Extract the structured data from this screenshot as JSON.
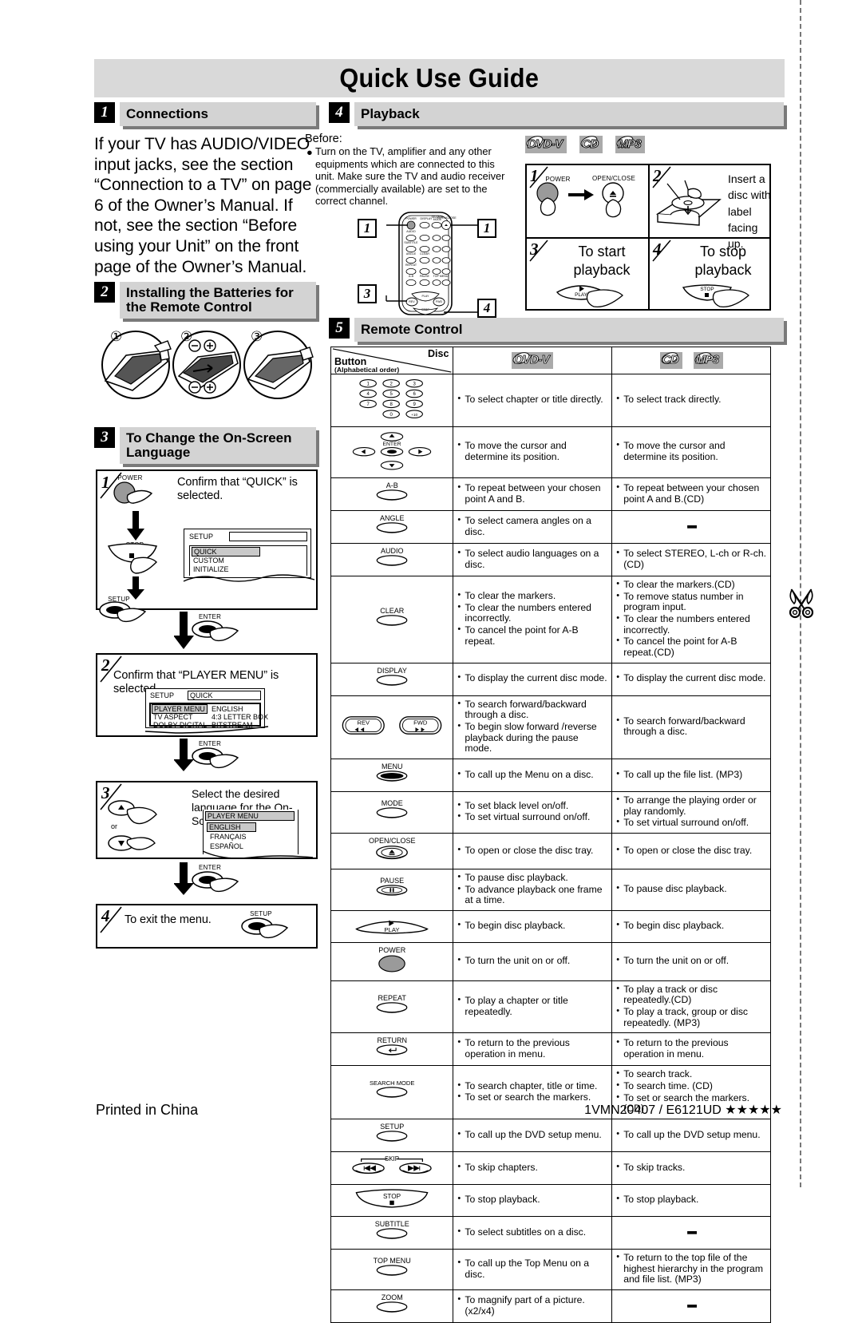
{
  "document": {
    "title": "Quick Use Guide",
    "footer_left": "Printed in China",
    "footer_right": "1VMN20407 / E6121UD ★★★★★"
  },
  "sections": {
    "connections": {
      "number": "1",
      "heading": "Connections",
      "body": "If your TV has AUDIO/VIDEO input jacks, see the section “Connection to a TV” on page 6 of the Owner’s Manual. If not, see the section “Before using your Unit” on the front page of the Owner’s Manual."
    },
    "batteries": {
      "number": "2",
      "heading": "Installing the Batteries for the Remote Control",
      "steps": [
        "1",
        "2",
        "3"
      ],
      "polarity": [
        "−",
        "+",
        "−",
        "+"
      ]
    },
    "language": {
      "number": "3",
      "heading": "To Change the On-Screen Language",
      "step1": {
        "number": "1",
        "instruction": "Confirm that “QUICK” is selected.",
        "buttons": [
          "POWER",
          "STOP",
          "SETUP"
        ],
        "osd_title": "SETUP",
        "osd_items": [
          "QUICK",
          "CUSTOM",
          "INITIALIZE"
        ],
        "osd_selected": "QUICK"
      },
      "connector1": "ENTER",
      "step2": {
        "number": "2",
        "instruction": "Confirm that “PLAYER MENU” is selected.",
        "osd_title": "SETUP",
        "osd_mode": "QUICK",
        "osd_rows": [
          {
            "label": "PLAYER MENU",
            "value": "ENGLISH"
          },
          {
            "label": "TV ASPECT",
            "value": "4:3 LETTER BOX"
          },
          {
            "label": "DOLBY DIGITAL",
            "value": "BITSTREAM"
          }
        ],
        "osd_selected": "PLAYER MENU"
      },
      "connector2": "ENTER",
      "step3": {
        "number": "3",
        "instruction": "Select the desired language for the On-Screen Display.",
        "or_label": "or",
        "osd_title": "PLAYER MENU",
        "osd_items": [
          "ENGLISH",
          "FRANÇAIS",
          "ESPAÑOL"
        ],
        "osd_selected": "ENGLISH"
      },
      "connector3": "ENTER",
      "step4": {
        "number": "4",
        "instruction": "To exit the menu.",
        "button": "SETUP"
      }
    },
    "playback": {
      "number": "4",
      "heading": "Playback",
      "before_label": "Before:",
      "before_text": "Turn on the TV, amplifier and any other equipments which are connected to this unit. Make sure the TV and audio receiver (commercially available) are set to the correct channel.",
      "disc_logos": [
        "DVD-V",
        "CD",
        "MP3"
      ],
      "remote_callouts": [
        "1",
        "1",
        "3",
        "4"
      ],
      "remote_labels": [
        "POWER",
        "DISPLAY",
        "SEARCH MODE",
        "OPEN/CLOSE",
        "AUDIO",
        "SUBTITLE",
        "ANGLE",
        "REPEAT",
        "CLEAR",
        "A-B",
        "PAUSE",
        "TOP MENU",
        "REV",
        "PLAY",
        "FWD",
        "STOP"
      ],
      "steps": [
        {
          "number": "1",
          "text": "",
          "button_left": "POWER",
          "button_right": "OPEN/CLOSE"
        },
        {
          "number": "2",
          "text": "Insert a disc with label facing up."
        },
        {
          "number": "3",
          "text": "To start playback",
          "button": "PLAY"
        },
        {
          "number": "4",
          "text": "To stop playback",
          "button": "STOP"
        }
      ]
    },
    "remote_control": {
      "number": "5",
      "heading": "Remote Control",
      "table": {
        "header": {
          "col1_top": "Disc",
          "col1_bottom": "Button",
          "col1_sub": "(Alphabetical order)",
          "col2": "DVD-V",
          "col3a": "CD",
          "col3b": "MP3"
        },
        "rows": [
          {
            "button": "NUMBERS",
            "button_keys": [
              "1",
              "2",
              "3",
              "4",
              "5",
              "6",
              "7",
              "8",
              "9",
              "0",
              "+10"
            ],
            "dvd": [
              "To select chapter or title directly."
            ],
            "cd": [
              "To select track directly."
            ]
          },
          {
            "button": "CURSOR/ENTER",
            "button_label": "ENTER",
            "dvd": [
              "To move the cursor and determine its position."
            ],
            "cd": [
              "To move the cursor and determine its position."
            ]
          },
          {
            "button": "A-B",
            "dvd": [
              "To repeat between your chosen point A and B."
            ],
            "cd": [
              "To repeat between your chosen point A and B.(CD)"
            ]
          },
          {
            "button": "ANGLE",
            "dvd": [
              "To select camera angles on a disc."
            ],
            "cd": []
          },
          {
            "button": "AUDIO",
            "dvd": [
              "To select audio languages on a disc."
            ],
            "cd": [
              "To select STEREO, L-ch or R-ch.(CD)"
            ]
          },
          {
            "button": "CLEAR",
            "dvd": [
              "To clear the markers.",
              "To clear the numbers entered incorrectly.",
              "To cancel the point for A-B repeat."
            ],
            "cd": [
              "To clear the markers.(CD)",
              "To remove status number in program input.",
              "To clear the numbers entered incorrectly.",
              "To cancel the point for A-B repeat.(CD)"
            ]
          },
          {
            "button": "DISPLAY",
            "dvd": [
              "To display the current disc mode."
            ],
            "cd": [
              "To display the current disc mode."
            ]
          },
          {
            "button": "REV/FWD",
            "button_left": "REV",
            "button_right": "FWD",
            "dvd": [
              "To search forward/backward through a disc.",
              "To begin slow forward /reverse playback during the pause mode."
            ],
            "cd": [
              "To search forward/backward through a disc."
            ]
          },
          {
            "button": "MENU",
            "dvd": [
              "To call up the Menu on a disc."
            ],
            "cd": [
              "To call up the file list. (MP3)"
            ]
          },
          {
            "button": "MODE",
            "dvd": [
              "To set black level on/off.",
              "To set virtual surround on/off."
            ],
            "cd": [
              "To arrange the playing order or play randomly.",
              "To set virtual surround on/off."
            ]
          },
          {
            "button": "OPEN/CLOSE",
            "dvd": [
              "To open or close the disc tray."
            ],
            "cd": [
              "To open or close the disc tray."
            ]
          },
          {
            "button": "PAUSE",
            "dvd": [
              "To pause disc playback.",
              "To advance playback one frame at a time."
            ],
            "cd": [
              "To pause disc playback."
            ]
          },
          {
            "button": "PLAY",
            "dvd": [
              "To begin disc playback."
            ],
            "cd": [
              "To begin disc playback."
            ]
          },
          {
            "button": "POWER",
            "dvd": [
              "To turn the unit on or off."
            ],
            "cd": [
              "To turn the unit on or off."
            ]
          },
          {
            "button": "REPEAT",
            "dvd": [
              "To play a chapter or title repeatedly."
            ],
            "cd": [
              "To play a track or disc repeatedly.(CD)",
              "To play a track, group or disc repeatedly. (MP3)"
            ]
          },
          {
            "button": "RETURN",
            "dvd": [
              "To return to the previous operation in menu."
            ],
            "cd": [
              "To return to the previous operation in menu."
            ]
          },
          {
            "button": "SEARCH MODE",
            "dvd": [
              "To search chapter, title or time.",
              "To set or search the markers."
            ],
            "cd": [
              "To search track.",
              "To search time. (CD)",
              "To set or search the markers. (CD)"
            ]
          },
          {
            "button": "SETUP",
            "dvd": [
              "To call up the DVD setup menu."
            ],
            "cd": [
              "To call up the DVD setup menu."
            ]
          },
          {
            "button": "SKIP",
            "dvd": [
              "To skip chapters."
            ],
            "cd": [
              "To skip tracks."
            ]
          },
          {
            "button": "STOP",
            "dvd": [
              "To stop playback."
            ],
            "cd": [
              "To stop playback."
            ]
          },
          {
            "button": "SUBTITLE",
            "dvd": [
              "To select subtitles on a disc."
            ],
            "cd": []
          },
          {
            "button": "TOP MENU",
            "dvd": [
              "To call up the Top Menu on a disc."
            ],
            "cd": [
              "To return to the top file of the highest hierarchy in the program and file list. (MP3)"
            ]
          },
          {
            "button": "ZOOM",
            "dvd": [
              "To magnify part of a picture. (x2/x4)"
            ],
            "cd": []
          }
        ]
      }
    }
  },
  "colors": {
    "header_gray": "#d9d9d9",
    "section_gray": "#d3d3d3",
    "shadow_gray": "#7a7a7a",
    "power_button": "#9a9a9a",
    "logo_gray": "#aaaaaa"
  }
}
